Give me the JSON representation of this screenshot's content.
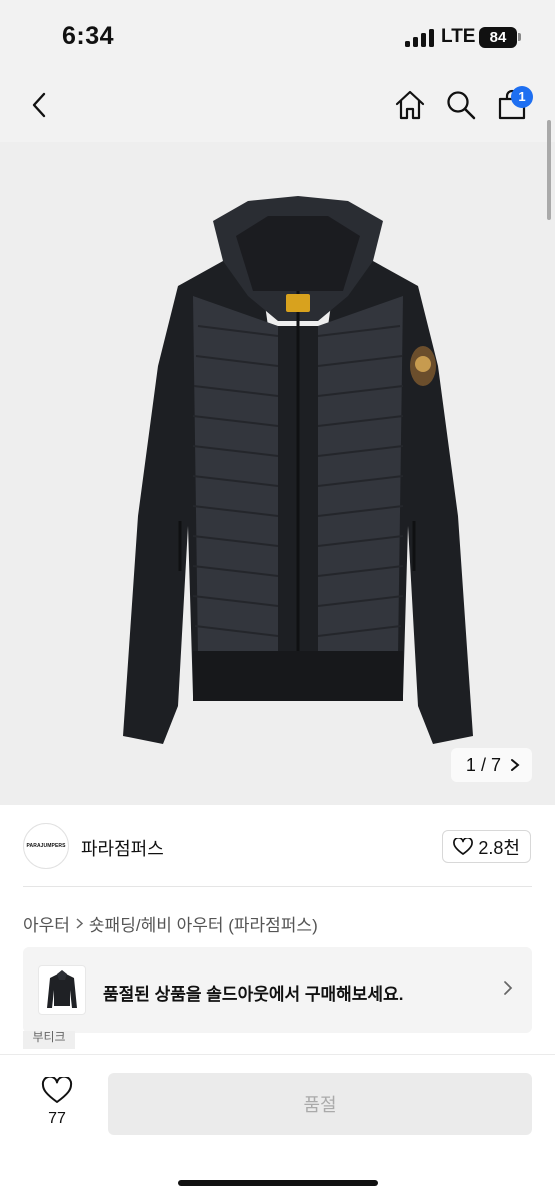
{
  "status": {
    "time": "6:34",
    "network": "LTE",
    "battery": "84"
  },
  "nav": {
    "cart_count": "1"
  },
  "gallery": {
    "current": "1",
    "separator": "/",
    "total": "7"
  },
  "shop": {
    "logo_small": "",
    "logo_text": "PARAJUMPERS",
    "name": "파라점퍼스",
    "likes": "2.8천"
  },
  "breadcrumb": {
    "level1": "아우터",
    "level2": "숏패딩/헤비 아우터 (파라점퍼스)"
  },
  "promo": {
    "text": "품절된 상품을 솔드아웃에서 구매해보세요."
  },
  "tag": {
    "label": "부티크"
  },
  "bottom": {
    "wish_count": "77",
    "action_label": "품절"
  },
  "colors": {
    "accent": "#1e6ff1",
    "nav_bg": "#f2f2f2",
    "button_disabled": "#ebebeb"
  },
  "icons": [
    "back-icon",
    "home-icon",
    "search-icon",
    "cart-icon",
    "heart-icon",
    "chevron-right-icon"
  ]
}
